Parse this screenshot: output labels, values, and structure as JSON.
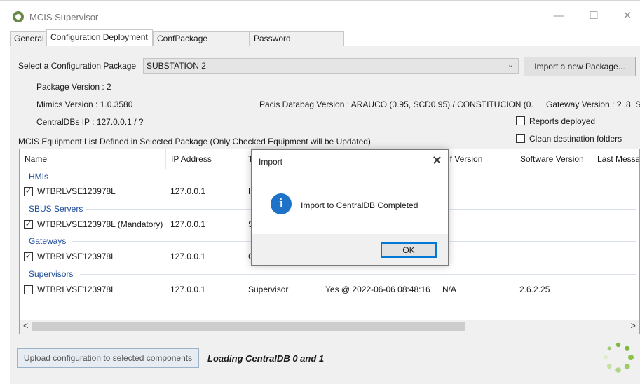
{
  "window": {
    "title": "MCIS Supervisor",
    "minimize_icon": "minimize-icon",
    "maximize_icon": "maximize-icon",
    "close_icon": "close-icon"
  },
  "tabs": [
    {
      "label": "General"
    },
    {
      "label": "Configuration Deployment",
      "active": true
    },
    {
      "label": "ConfPackage Generator"
    },
    {
      "label": "Password Management"
    }
  ],
  "package": {
    "select_label": "Select a Configuration Package",
    "selected": "SUBSTATION 2",
    "import_button": "Import a new Package...",
    "package_version": "Package Version : 2",
    "mimics_version": "Mimics Version : 1.0.3580",
    "centraldbs_ip": "CentralDBs IP : 127.0.0.1 / ?",
    "pacis_databag": "Pacis Databag Version : ARAUCO (0.95, SCD0.95) / CONSTITUCION (0.",
    "gateway_version": "Gateway Version : ? .8, S"
  },
  "options": {
    "reports_deployed": {
      "label": "Reports deployed",
      "checked": false
    },
    "clean_destination": {
      "label": "Clean destination folders",
      "checked": false
    }
  },
  "equipment_list": {
    "caption": "MCIS Equipment List Defined in Selected Package (Only Checked Equipment will be Updated)",
    "columns": [
      "Name",
      "IP Address",
      "T",
      "nf Version",
      "Software Version",
      "Last Messa"
    ],
    "groups": [
      {
        "name": "HMIs",
        "rows": [
          {
            "checked": true,
            "name": "WTBRLVSE123978L",
            "ip": "127.0.0.1",
            "type": "H",
            "deployed": "",
            "conf_version": "",
            "software_version": ""
          }
        ]
      },
      {
        "name": "SBUS Servers",
        "rows": [
          {
            "checked": true,
            "name": "WTBRLVSE123978L (Mandatory)",
            "ip": "127.0.0.1",
            "type": "S",
            "deployed": "",
            "conf_version": "",
            "software_version": ""
          }
        ]
      },
      {
        "name": "Gateways",
        "rows": [
          {
            "checked": true,
            "name": "WTBRLVSE123978L",
            "ip": "127.0.0.1",
            "type": "G",
            "deployed": "",
            "conf_version": "",
            "software_version": ""
          }
        ]
      },
      {
        "name": "Supervisors",
        "rows": [
          {
            "checked": false,
            "name": "WTBRLVSE123978L",
            "ip": "127.0.0.1",
            "type": "Supervisor",
            "deployed": "Yes @ 2022-06-06 08:48:16",
            "conf_version": "N/A",
            "software_version": "2.6.2.25"
          }
        ]
      }
    ],
    "scroll_left": "<",
    "scroll_right": ">"
  },
  "footer": {
    "upload_button": "Upload configuration to selected components",
    "loading_text": "Loading CentralDB 0 and 1",
    "spinner_icon": "loading-spinner-icon"
  },
  "dialog": {
    "title": "Import",
    "message": "Import to CentralDB Completed",
    "icon": "info-icon",
    "ok_label": "OK"
  }
}
